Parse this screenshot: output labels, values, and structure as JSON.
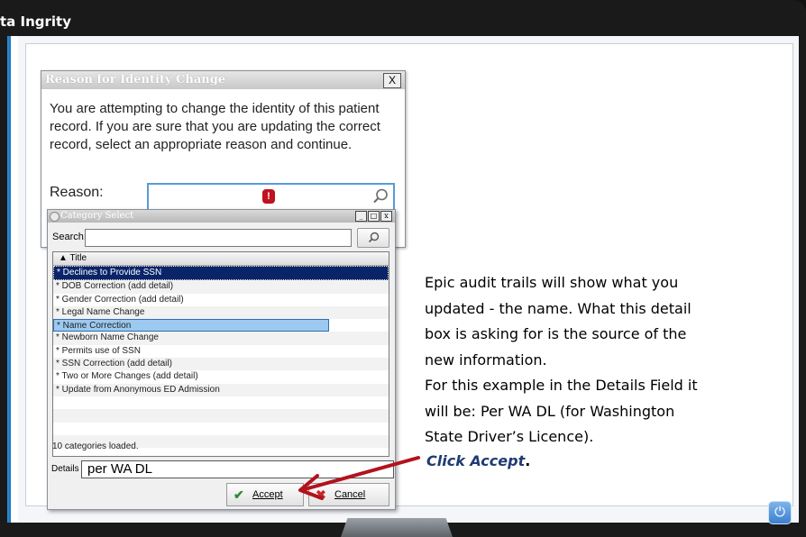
{
  "window": {
    "title": "ta Ingrity"
  },
  "reason_dialog": {
    "title": "Reason for Identity Change",
    "close_glyph": "X",
    "message": "You are attempting to change the identity of this patient record. If you are sure that you are updating the correct record, select an appropriate reason and continue.",
    "reason_label": "Reason:",
    "reason_value": "",
    "required_icon": "exclamation",
    "search_icon": "magnifier"
  },
  "category_dialog": {
    "title": "Category Select",
    "window_buttons": [
      "_",
      "□",
      "x"
    ],
    "search_label": "Search:",
    "search_value": "",
    "column_header": "▲  Title",
    "items": [
      "* Declines to Provide SSN",
      "* DOB Correction (add detail)",
      "* Gender Correction (add detail)",
      "* Legal Name Change",
      "* Name Correction",
      "* Newborn Name Change",
      "* Permits use of SSN",
      "* SSN Correction (add detail)",
      "* Two or More Changes (add detail)",
      "* Update from Anonymous ED Admission"
    ],
    "selected_index": 0,
    "highlighted_index": 4,
    "status": "10 categories loaded.",
    "details_label": "Details",
    "details_value": "per WA DL",
    "accept_label": "Accept",
    "cancel_label": "Cancel"
  },
  "annotation": {
    "lines": [
      "Epic audit trails will show what you",
      "updated - the name.  What this detail",
      "box is asking for is the source of the",
      "new information.",
      "For this example in the Details Field it",
      "will be: Per WA DL (for Washington",
      "State Driver’s Licence)."
    ],
    "click_text": "Click Accept",
    "click_suffix": "."
  },
  "colors": {
    "selected_row": "#0a246a",
    "highlight_row": "#9cc9ef",
    "arrow": "#b3121c",
    "click_text": "#1f3b73"
  }
}
